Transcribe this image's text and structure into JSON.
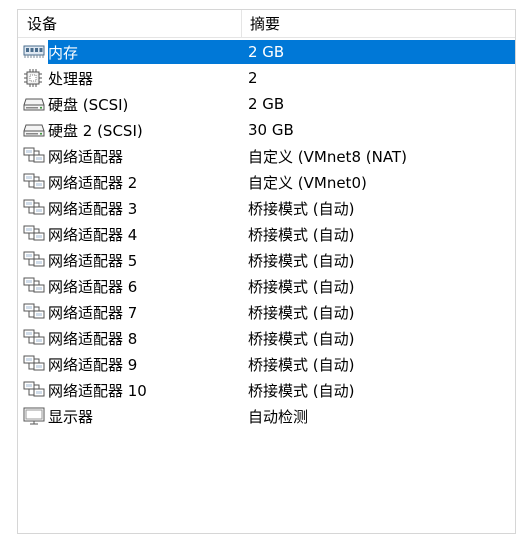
{
  "header": {
    "device_col": "设备",
    "summary_col": "摘要"
  },
  "rows": [
    {
      "icon": "memory-icon",
      "label": "内存",
      "summary": "2 GB",
      "selected": true
    },
    {
      "icon": "processor-icon",
      "label": "处理器",
      "summary": "2",
      "selected": false
    },
    {
      "icon": "hard-disk-icon",
      "label": "硬盘 (SCSI)",
      "summary": "2 GB",
      "selected": false
    },
    {
      "icon": "hard-disk-icon",
      "label": "硬盘 2 (SCSI)",
      "summary": "30 GB",
      "selected": false
    },
    {
      "icon": "network-adapter-icon",
      "label": "网络适配器",
      "summary": "自定义 (VMnet8 (NAT)",
      "selected": false
    },
    {
      "icon": "network-adapter-icon",
      "label": "网络适配器 2",
      "summary": "自定义 (VMnet0)",
      "selected": false
    },
    {
      "icon": "network-adapter-icon",
      "label": "网络适配器 3",
      "summary": "桥接模式 (自动)",
      "selected": false
    },
    {
      "icon": "network-adapter-icon",
      "label": "网络适配器 4",
      "summary": "桥接模式 (自动)",
      "selected": false
    },
    {
      "icon": "network-adapter-icon",
      "label": "网络适配器 5",
      "summary": "桥接模式 (自动)",
      "selected": false
    },
    {
      "icon": "network-adapter-icon",
      "label": "网络适配器 6",
      "summary": "桥接模式 (自动)",
      "selected": false
    },
    {
      "icon": "network-adapter-icon",
      "label": "网络适配器 7",
      "summary": "桥接模式 (自动)",
      "selected": false
    },
    {
      "icon": "network-adapter-icon",
      "label": "网络适配器 8",
      "summary": "桥接模式 (自动)",
      "selected": false
    },
    {
      "icon": "network-adapter-icon",
      "label": "网络适配器 9",
      "summary": "桥接模式 (自动)",
      "selected": false
    },
    {
      "icon": "network-adapter-icon",
      "label": "网络适配器 10",
      "summary": "桥接模式 (自动)",
      "selected": false
    },
    {
      "icon": "display-icon",
      "label": "显示器",
      "summary": "自动检测",
      "selected": false
    }
  ],
  "colors": {
    "selection": "#0078d7",
    "border": "#d6d6d6"
  }
}
